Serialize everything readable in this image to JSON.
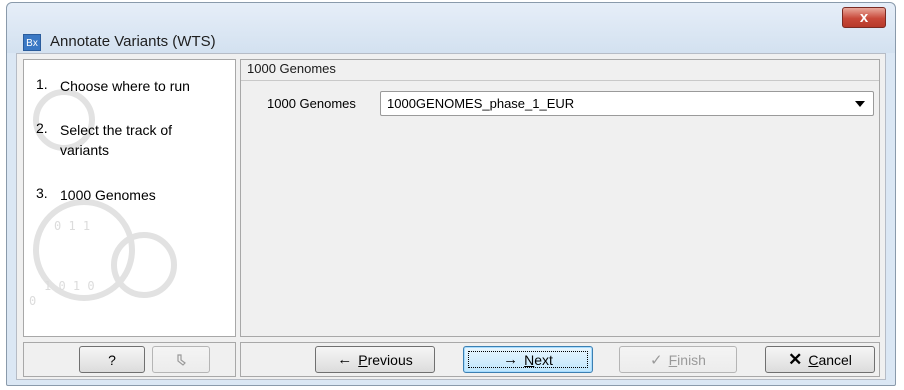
{
  "window": {
    "icon_text": "Bx",
    "title": "Annotate Variants (WTS)",
    "close_glyph": "x"
  },
  "steps": [
    {
      "num": "1.",
      "label": "Choose where to run"
    },
    {
      "num": "2.",
      "label": "Select the track of variants"
    },
    {
      "num": "3.",
      "label": "1000 Genomes"
    }
  ],
  "panel": {
    "title": "1000 Genomes",
    "field_label": "1000 Genomes",
    "select_value": "1000GENOMES_phase_1_EUR"
  },
  "buttons": {
    "help": {
      "label": "?"
    },
    "reset": {
      "icon": "undo-icon"
    },
    "previous": {
      "icon": "arrow-left-icon",
      "prefix": "",
      "mnemonic": "P",
      "rest": "revious"
    },
    "next": {
      "icon": "arrow-right-icon",
      "mnemonic": "N",
      "rest": "ext"
    },
    "finish": {
      "icon": "check-icon",
      "mnemonic": "F",
      "rest": "inish"
    },
    "cancel": {
      "icon": "close-x-icon",
      "mnemonic": "C",
      "rest": "ancel"
    }
  },
  "colors": {
    "default_button_border": "#3c7fb1",
    "close_button": "#c8493a",
    "app_icon": "#3a78c4"
  }
}
